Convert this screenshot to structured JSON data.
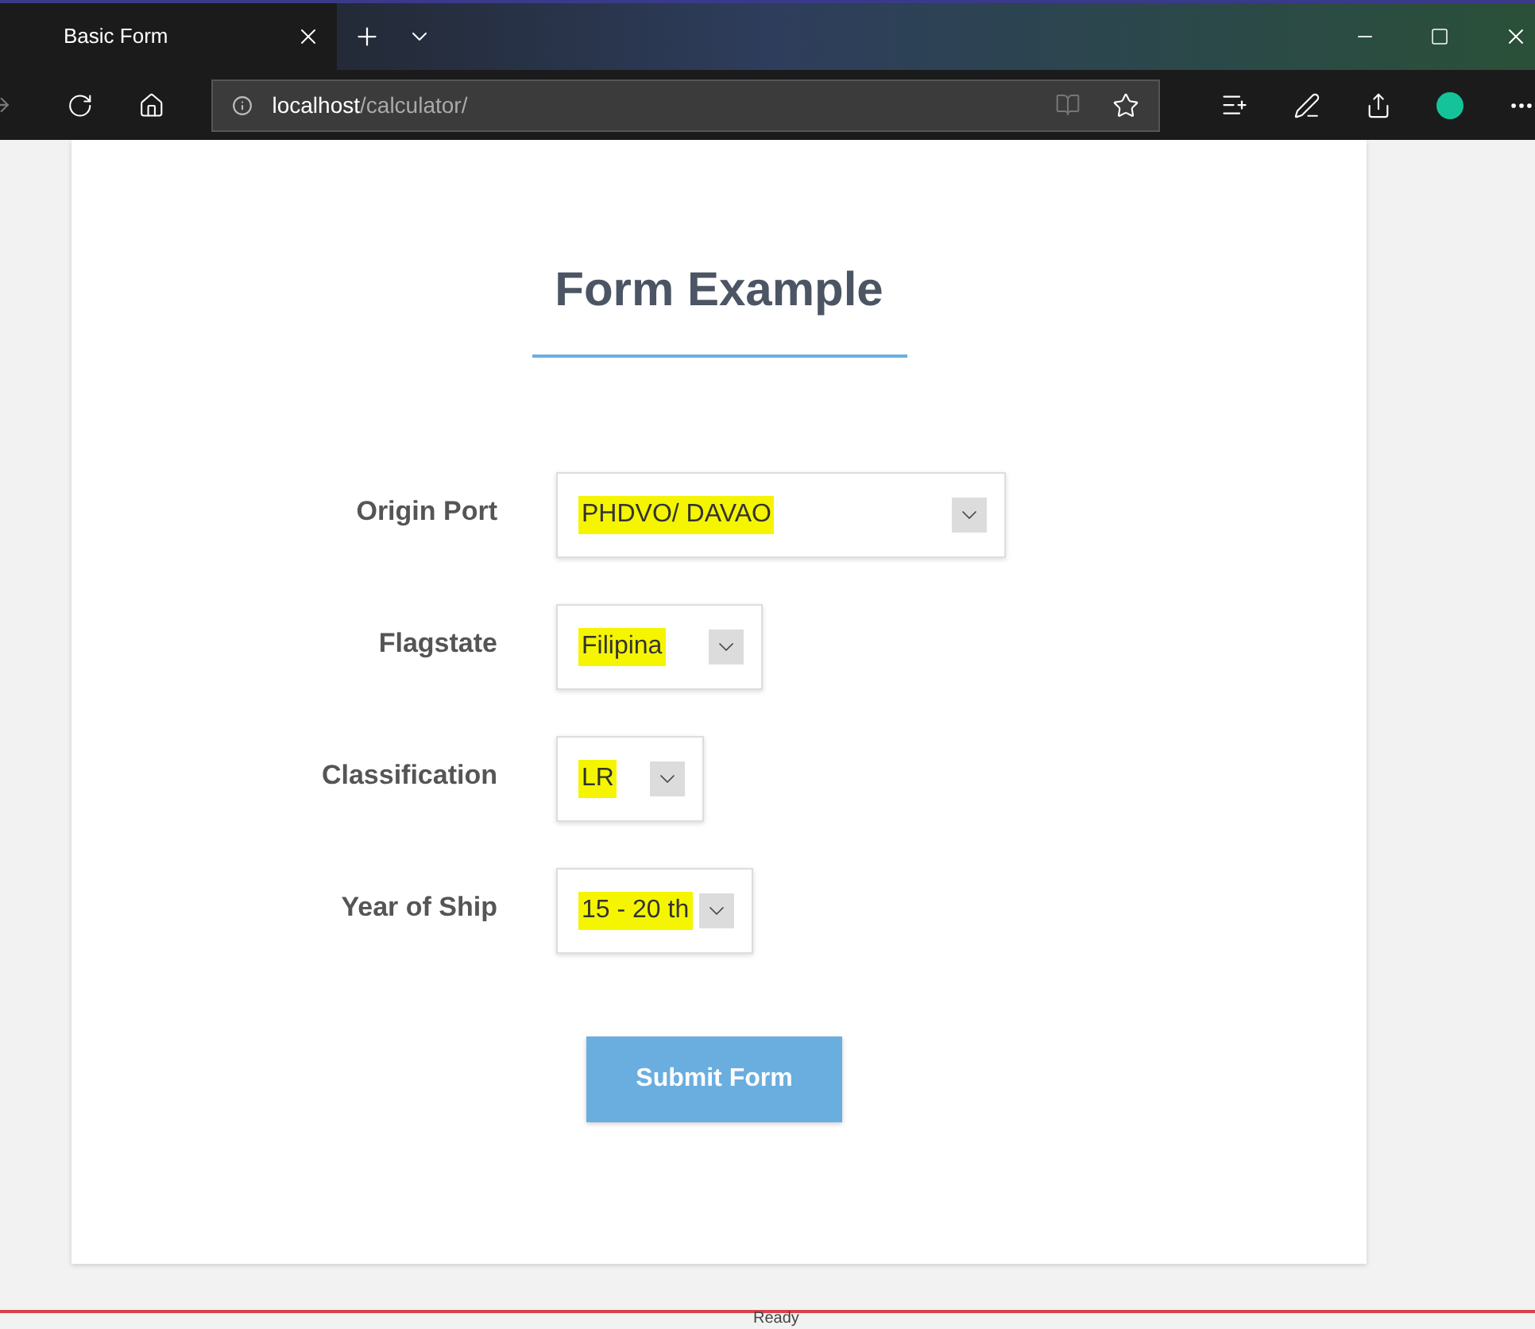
{
  "tab": {
    "title": "Basic Form",
    "selected": true
  },
  "address_bar": {
    "host": "localhost",
    "path": "/calculator/"
  },
  "form": {
    "title": "Form Example",
    "fields": [
      {
        "label": "Origin Port",
        "value": "PHDVO/ DAVAO",
        "highlighted": true
      },
      {
        "label": "Flagstate",
        "value": "Filipina",
        "highlighted": true
      },
      {
        "label": "Classification",
        "value": "LR",
        "highlighted": true
      },
      {
        "label": "Year of Ship",
        "value": "15 - 20 th",
        "highlighted": true
      }
    ],
    "submit": "Submit Form"
  },
  "status_bar": {
    "text": "Ready"
  }
}
